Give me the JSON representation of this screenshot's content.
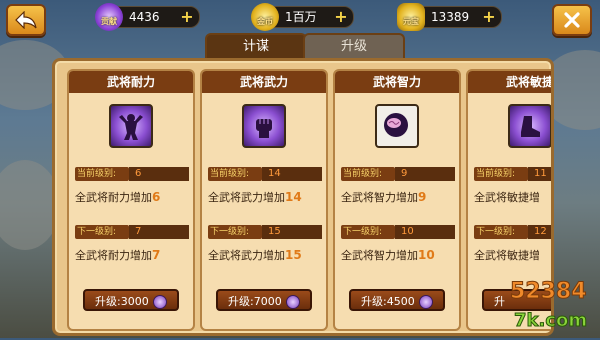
{
  "topbar": {
    "resources": [
      {
        "icon": "contribution-gem-icon",
        "caption": "贡献",
        "value": "4436"
      },
      {
        "icon": "gold-coin-icon",
        "caption": "金币",
        "value": "1百万"
      },
      {
        "icon": "treasure-ingot-icon",
        "caption": "元宝",
        "value": "13389"
      }
    ],
    "plus": "+"
  },
  "tabs": [
    {
      "label": "计谋"
    },
    {
      "label": "升级"
    }
  ],
  "cards": [
    {
      "title": "武将耐力",
      "icon": "strength-body-icon",
      "current_label": "当前级别:",
      "current_level": "6",
      "current_desc": "全武将耐力增加",
      "current_value": "6",
      "next_label": "下一级别:",
      "next_level": "7",
      "next_desc": "全武将耐力增加",
      "next_value": "7",
      "button": "升级:3000"
    },
    {
      "title": "武将武力",
      "icon": "fist-icon",
      "current_label": "当前级别:",
      "current_level": "14",
      "current_desc": "全武将武力增加",
      "current_value": "14",
      "next_label": "下一级别:",
      "next_level": "15",
      "next_desc": "全武将武力增加",
      "next_value": "15",
      "button": "升级:7000"
    },
    {
      "title": "武将智力",
      "icon": "brain-icon",
      "current_label": "当前级别:",
      "current_level": "9",
      "current_desc": "全武将智力增加",
      "current_value": "9",
      "next_label": "下一级别:",
      "next_level": "10",
      "next_desc": "全武将智力增加",
      "next_value": "10",
      "button": "升级:4500"
    },
    {
      "title": "武将敏捷",
      "icon": "boot-icon",
      "current_label": "当前级别:",
      "current_level": "11",
      "current_desc": "全武将敏捷增",
      "current_value": "",
      "next_label": "下一级别:",
      "next_level": "12",
      "next_desc": "全武将敏捷增",
      "next_value": "",
      "button": "升"
    }
  ],
  "watermark": {
    "line1": "52384",
    "line2": "7k.com"
  }
}
